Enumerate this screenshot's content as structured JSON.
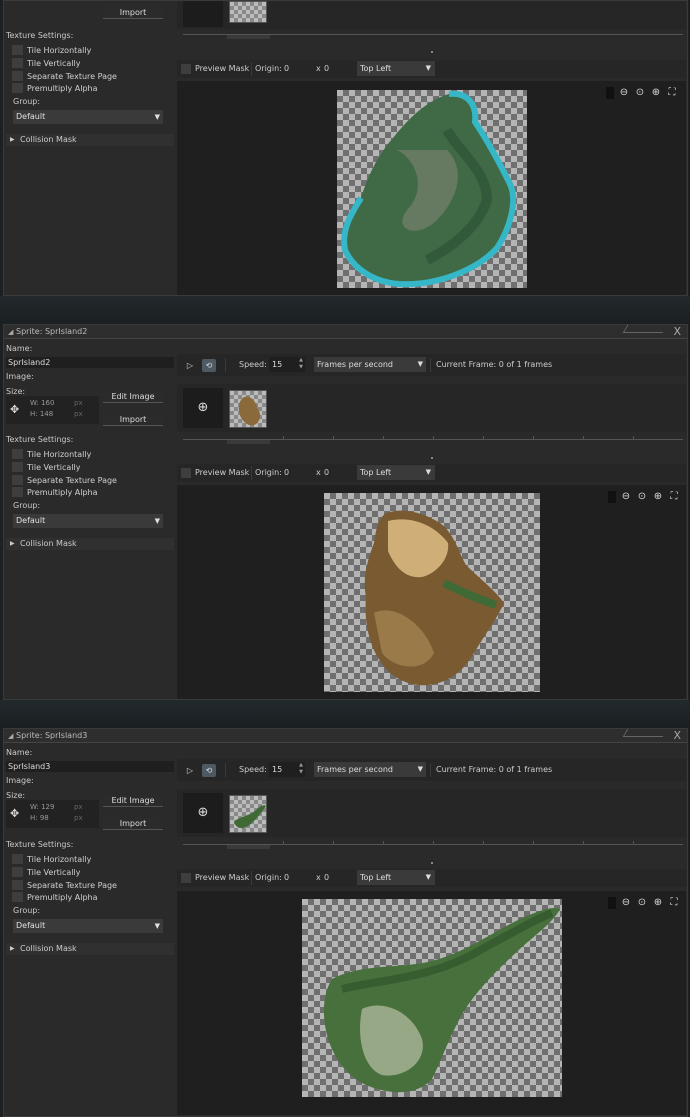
{
  "common": {
    "name_label": "Name:",
    "image_label": "Image:",
    "size_label": "Size:",
    "edit_image": "Edit Image",
    "import": "Import",
    "texture_settings": "Texture Settings:",
    "tile_h": "Tile Horizontally",
    "tile_v": "Tile Vertically",
    "separate_page": "Separate Texture Page",
    "premultiply": "Premultiply Alpha",
    "group_label": "Group:",
    "group_value": "Default",
    "collision_mask": "Collision Mask",
    "speed_label": "Speed:",
    "fps_unit": "Frames per second",
    "preview_mask": "Preview Mask",
    "origin_label": "Origin:",
    "origin_x": "0",
    "x_sep": "x",
    "origin_y": "0",
    "origin_preset": "Top Left",
    "px": "px",
    "close_glyph": "X",
    "add_glyph": "⊕"
  },
  "sprites": [
    {
      "title": "",
      "name": "",
      "width": "",
      "height": "",
      "speed": "",
      "current_frame": ""
    },
    {
      "title": "Sprite: SprIsland2",
      "name": "SprIsland2",
      "width": "W: 160",
      "height": "H: 148",
      "speed": "15",
      "current_frame": "Current Frame: 0 of 1 frames"
    },
    {
      "title": "Sprite: SprIsland3",
      "name": "SprIsland3",
      "width": "W: 129",
      "height": "H: 98",
      "speed": "15",
      "current_frame": "Current Frame: 0 of 1 frames"
    }
  ],
  "icons": [
    "play-icon",
    "loop-icon",
    "resize-icon",
    "zoom-out-icon",
    "zoom-reset-icon",
    "zoom-in-icon",
    "fit-screen-icon",
    "collapse-triangle-icon",
    "dropdown-arrow-icon",
    "close-icon"
  ]
}
